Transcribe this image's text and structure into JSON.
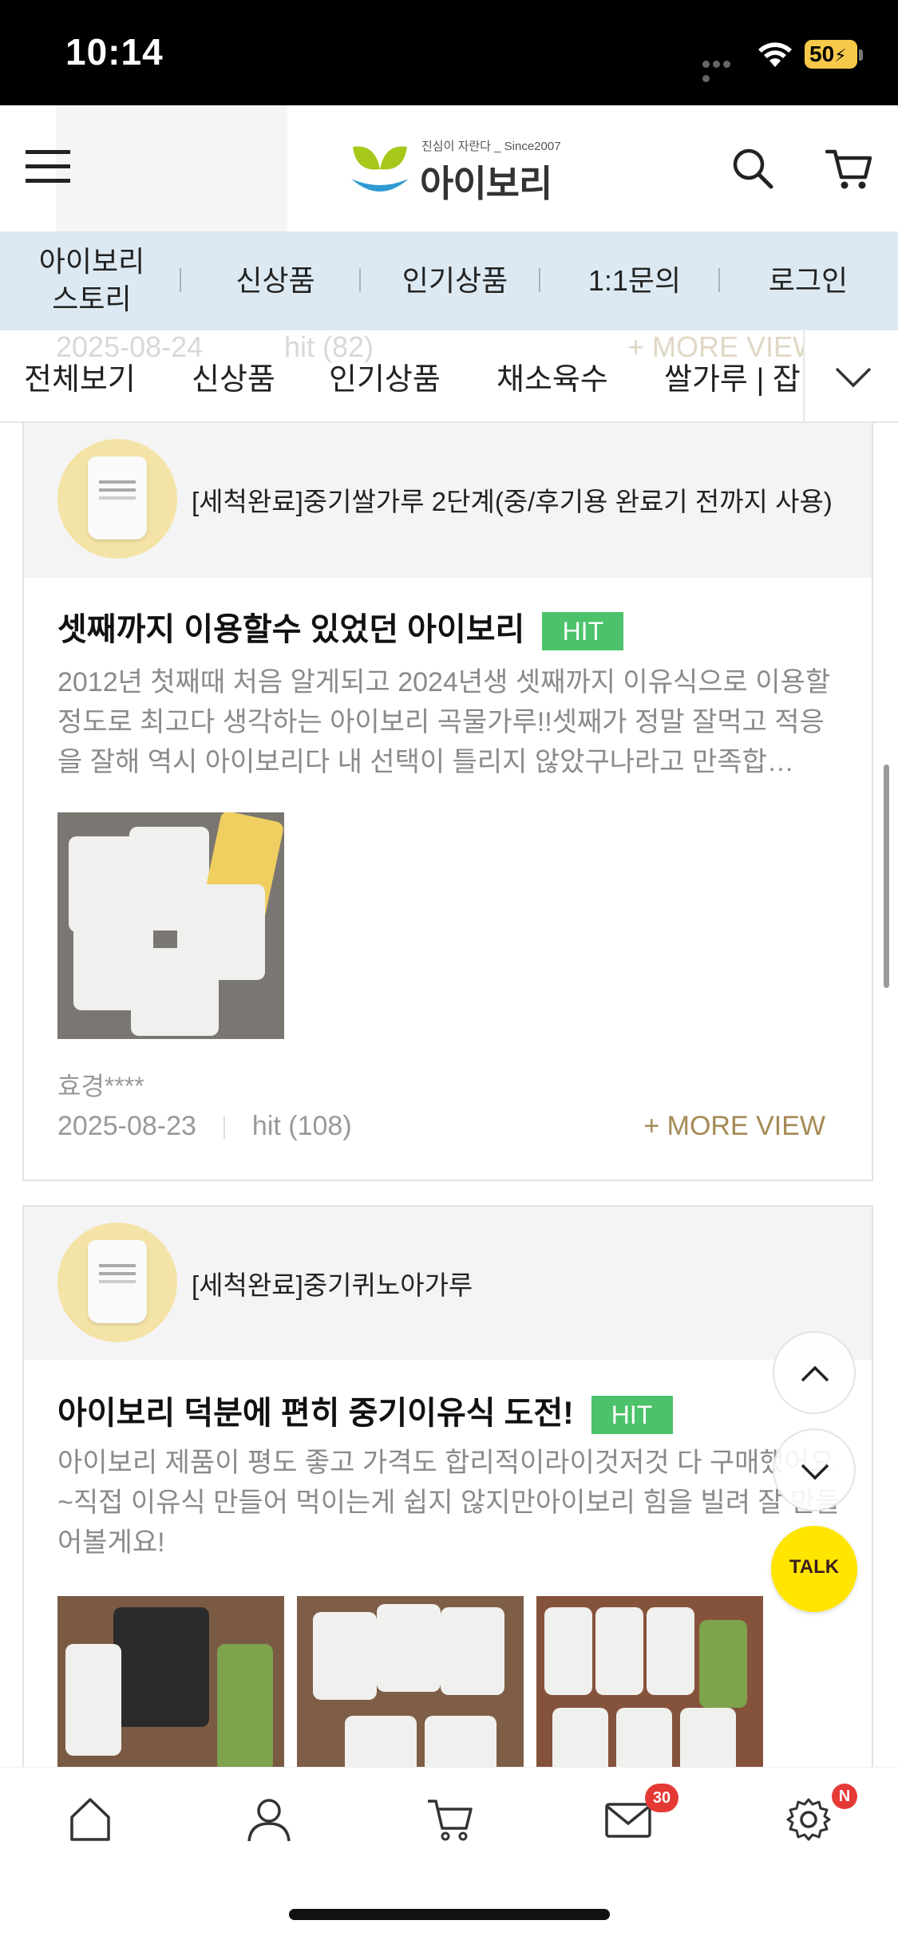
{
  "status_bar": {
    "time": "10:14",
    "battery": "50"
  },
  "header": {
    "logo_tagline": "진심이 자란다 _ Since2007",
    "logo_text": "아이보리"
  },
  "top_nav": {
    "items": [
      "아이보리\n스토리",
      "신상품",
      "인기상품",
      "1:1문의",
      "로그인"
    ]
  },
  "ghost_row": {
    "date": "2025-08-24",
    "hit": "hit (82)",
    "more": "+ MORE VIEW"
  },
  "category_nav": {
    "items": [
      "전체보기",
      "신상품",
      "인기상품",
      "채소육수",
      "쌀가루 | 잡"
    ]
  },
  "reviews": [
    {
      "product_name": "[세척완료]중기쌀가루 2단계(중/후기용 완료기 전까지 사용)",
      "title": "셋째까지 이용할수 있었던 아이보리",
      "badge": "HIT",
      "body": "2012년 첫째때 처음 알게되고 2024년생 셋째까지 이유식으로 이용할정도로 최고다 생각하는 아이보리 곡물가루!!셋째가 정말 잘먹고 적응을 잘해 역시 아이보리다 내 선택이 틀리지 않았구나라고 만족합…",
      "author": "효경****",
      "date": "2025-08-23",
      "hit": "hit (108)",
      "more": "+ MORE VIEW"
    },
    {
      "product_name": "[세척완료]중기퀴노아가루",
      "title": "아이보리 덕분에 편히 중기이유식 도전!",
      "badge": "HIT",
      "body": "아이보리 제품이 평도 좋고 가격도 합리적이라이것저것 다 구매했어요~직접 이유식 만들어 먹이는게 쉽지 않지만아이보리 힘을 빌려 잘 만들어볼게요!"
    }
  ],
  "floating": {
    "talk_label": "TALK"
  },
  "tab_bar": {
    "mail_badge": "30",
    "settings_badge": "N"
  },
  "colors": {
    "accent_green": "#4cc36a",
    "nav_bg": "#dde9f2",
    "more_gold": "#a58a55",
    "talk_yellow": "#ffe500"
  }
}
